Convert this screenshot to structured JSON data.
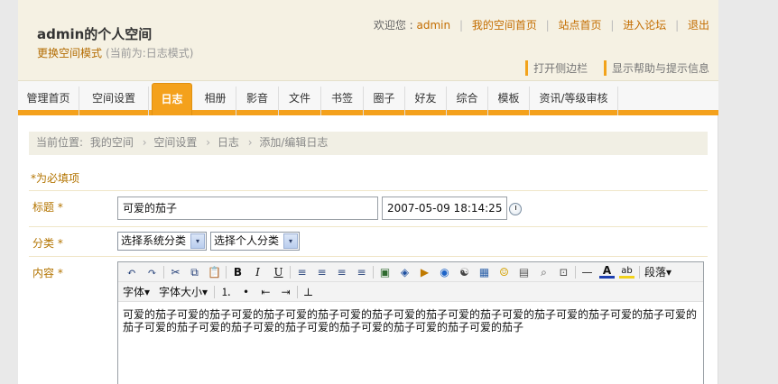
{
  "header": {
    "title": "admin的个人空间",
    "switch_mode": "更换空间模式",
    "current_mode": "(当前为:日志模式)",
    "welcome": "欢迎您 :",
    "username": "admin",
    "links": [
      "我的空间首页",
      "站点首页",
      "进入论坛",
      "退出"
    ],
    "tips": [
      "打开侧边栏",
      "显示帮助与提示信息"
    ]
  },
  "nav": {
    "tabs": [
      "管理首页",
      "空间设置",
      "日志",
      "相册",
      "影音",
      "文件",
      "书签",
      "圈子",
      "好友",
      "综合",
      "模板",
      "资讯/等级审核"
    ],
    "active": "日志"
  },
  "breadcrumb": {
    "prefix": "当前位置:",
    "items": [
      "我的空间",
      "空间设置",
      "日志",
      "添加/编辑日志"
    ],
    "arrow": "›"
  },
  "form": {
    "required_note": "*为必填项",
    "title_label": "标题 *",
    "title_value": "可爱的茄子",
    "date_value": "2007-05-09 18:14:25",
    "category_label": "分类 *",
    "system_category": "选择系统分类",
    "personal_category": "选择个人分类",
    "content_label": "内容 *",
    "content_text": "可爱的茄子可爱的茄子可爱的茄子可爱的茄子可爱的茄子可爱的茄子可爱的茄子可爱的茄子可爱的茄子可爱的茄子可爱的茄子可爱的茄子可爱的茄子可爱的茄子可爱的茄子可爱的茄子可爱的茄子可爱的茄子"
  },
  "editor": {
    "icons": {
      "undo": "↶",
      "redo": "↷",
      "cut": "✂",
      "copy": "⧉",
      "paste": "📋",
      "bold": "B",
      "italic": "I",
      "underline": "U",
      "align_left": "≡",
      "align_center": "≡",
      "align_right": "≡",
      "justify": "≡",
      "image": "▣",
      "flash": "◈",
      "media": "▶",
      "real": "◉",
      "emoticon_special": "☯",
      "table": "▦",
      "smiley": "☺",
      "doc": "▤",
      "search": "⌕",
      "copyformat": "⊡",
      "hr": "—",
      "fontcolor": "A",
      "bgcolor": "ab",
      "ordered_list": "⒈",
      "unordered_list": "•",
      "outdent": "⇤",
      "indent": "⇥",
      "removeformat": "⊥"
    },
    "paragraph": "段落",
    "font": "字体",
    "font_size": "字体大小",
    "dropdown": "▾"
  },
  "colors": {
    "accent": "#f4a11c",
    "label": "#b37400",
    "header_bg": "#f5f1e3"
  }
}
